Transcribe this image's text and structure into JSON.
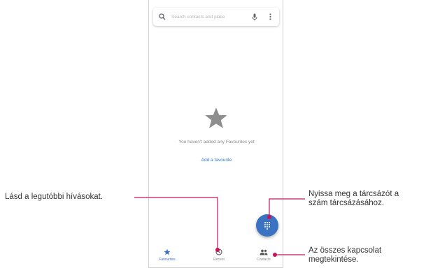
{
  "search": {
    "placeholder": "Search contacts and place"
  },
  "empty_state": {
    "message": "You haven't added any Favourites yet",
    "add_link": "Add a favourite"
  },
  "nav": {
    "items": [
      {
        "label": "Favourites",
        "icon": "star-icon",
        "active": true
      },
      {
        "label": "Recent",
        "icon": "clock-icon",
        "active": false
      },
      {
        "label": "Contacts",
        "icon": "people-icon",
        "active": false
      }
    ]
  },
  "callouts": {
    "recent": "Lásd a legutóbbi hívásokat.",
    "dialpad_line1": "Nyissa meg a tárcsázót a",
    "dialpad_line2": "szám tárcsázásához.",
    "contacts_line1": "Az összes kapcsolat",
    "contacts_line2": "megtekintése."
  },
  "colors": {
    "accent": "#3b72c2",
    "callout_line": "#c2185b",
    "link": "#2e7bd6"
  }
}
